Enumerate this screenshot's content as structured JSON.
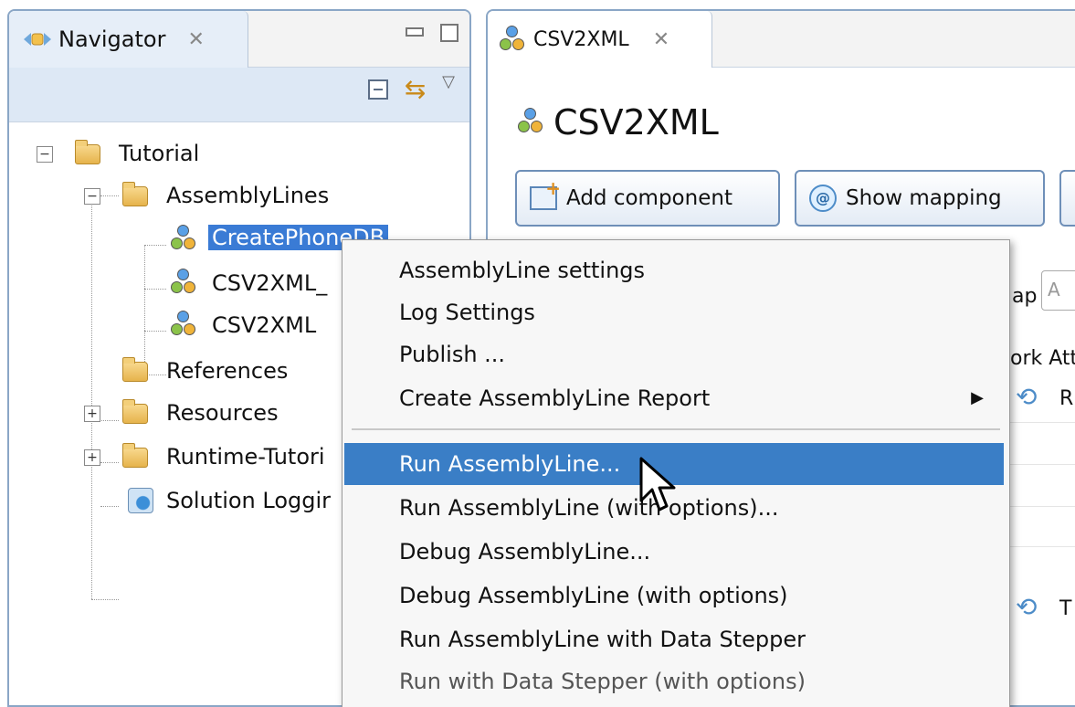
{
  "navigator": {
    "tab_label": "Navigator",
    "close_glyph": "✕",
    "tree": [
      {
        "label": "Tutorial",
        "expander": "−"
      },
      {
        "label": "AssemblyLines",
        "expander": "−"
      },
      {
        "label": "CreatePhoneDB",
        "selected": true
      },
      {
        "label": "CSV2XML_"
      },
      {
        "label": "CSV2XML"
      },
      {
        "label": "References"
      },
      {
        "label": "Resources",
        "expander": "+"
      },
      {
        "label": "Runtime-Tutori",
        "expander": "+"
      },
      {
        "label": "Solution Loggir"
      }
    ]
  },
  "editor": {
    "tab_label": "CSV2XML",
    "title": "CSV2XML",
    "buttons": {
      "add_component": "Add component",
      "show_mapping": "Show mapping"
    },
    "partial_texts": {
      "map": "ap",
      "input": "A",
      "work_attr": "ork Att",
      "hook1": "R",
      "hook2": "T"
    }
  },
  "context_menu": {
    "items": [
      "AssemblyLine settings",
      "Log Settings",
      "Publish ...",
      "Create AssemblyLine Report",
      "Run AssemblyLine...",
      "Run AssemblyLine (with options)...",
      "Debug AssemblyLine...",
      "Debug AssemblyLine (with options)",
      "Run AssemblyLine with Data Stepper",
      "Run with Data Stepper (with options)"
    ],
    "submenu_arrow": "▶",
    "highlighted_index": 4
  },
  "colors": {
    "selection": "#3a7bd5",
    "menu_highlight": "#3a7ec6",
    "view_border": "#8aa6c6"
  }
}
